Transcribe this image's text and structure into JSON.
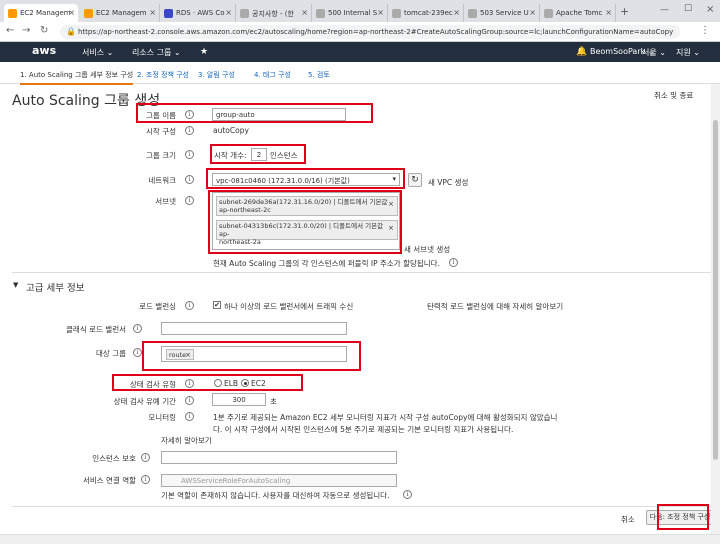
{
  "browser": {
    "tabs": [
      {
        "label": "EC2 Managem",
        "color": "#f90"
      },
      {
        "label": "EC2 Managem",
        "color": "#f90"
      },
      {
        "label": "RDS · AWS Co",
        "color": "#3b48cc"
      },
      {
        "label": "공지사항 - (한",
        "color": "#888"
      },
      {
        "label": "500 Internal S",
        "color": "#888"
      },
      {
        "label": "tomcat-239ec",
        "color": "#888"
      },
      {
        "label": "503 Service U",
        "color": "#888"
      },
      {
        "label": "Apache Tomc",
        "color": "#888"
      }
    ],
    "url": "https://ap-northeast-2.console.aws.amazon.com/ec2/autoscaling/home?region=ap-northeast-2#CreateAutoScalingGroup:source=lc;launchConfigurationName=autoCopy"
  },
  "nav": {
    "logo": "aws",
    "services": "서비스 ⌄",
    "resource_groups": "리소스 그룹 ⌄",
    "user": "BeomSooPark ⌄",
    "region": "서울 ⌄",
    "support": "지원 ⌄"
  },
  "steps": [
    "1. Auto Scaling 그룹 세부 정보 구성",
    "2. 조정 정책 구성",
    "3. 알림 구성",
    "4. 태그 구성",
    "5. 검토"
  ],
  "page": {
    "title": "Auto Scaling 그룹 생성",
    "cancel_review": "취소 및 종료"
  },
  "form": {
    "group_name_label": "그룹 이름",
    "group_name_value": "group-auto",
    "launch_config_label": "시작 구성",
    "launch_config_value": "autoCopy",
    "group_size_label": "그룹 크기",
    "group_size_prefix": "시작 개수:",
    "group_size_value": "2",
    "group_size_suffix": "인스턴스",
    "network_label": "네트워크",
    "network_value": "vpc-081c0460 (172.31.0.0/16) (기본값)",
    "new_vpc": "새 VPC 생성",
    "subnet_label": "서브넷",
    "subnets": [
      {
        "line1": "subnet-269de36a(172.31.16.0/20) | 디폴트에서 기본값",
        "line2": "ap-northeast-2c"
      },
      {
        "line1": "subnet-04313b6c(172.31.0.0/20) | 디폴트에서 기본값 ap-",
        "line2": "northeast-2a"
      }
    ],
    "new_subnet": "새 서브넷 생성",
    "subnet_note": "현재 Auto Scaling 그룹의 각 인스턴스에 퍼블릭 IP 주소가 할당됩니다."
  },
  "advanced": {
    "title": "고급 세부 정보",
    "lb_label": "로드 밸런싱",
    "lb_check": "하나 이상의 로드 밸런서에서 트래픽 수신",
    "lb_link": "탄력적 로드 밸런싱에 대해 자세히 알아보기",
    "classic_lb_label": "클래식 로드 밸런서",
    "target_group_label": "대상 그룹",
    "target_group_tag": "route",
    "health_check_label": "상태 검사 유형",
    "health_elb": "ELB",
    "health_ec2": "EC2",
    "grace_label": "상태 검사 유예 기간",
    "grace_value": "300",
    "grace_unit": "초",
    "monitoring_label": "모니터링",
    "monitoring_text1": "1분 주기로 제공되는 Amazon EC2 세부 모니터링 지표가 시작 구성 autoCopy에 대해 활성화되지 않았습니",
    "monitoring_text2": "다. 이 시작 구성에서 시작된 인스턴스에 5분 주기로 제공되는 기본 모니터링 지표가 사용됩니다.",
    "monitoring_link": "자세히 알아보기",
    "protect_label": "인스턴스 보호",
    "slr_label": "서비스 연결 역할",
    "slr_value": "AWSServiceRoleForAutoScaling",
    "slr_note": "기본 역할이 존재하지 않습니다. 사용자를 대신하여 자동으로 생성됩니다."
  },
  "footer": {
    "cancel": "취소",
    "next": "다음: 조정 정책 구성"
  },
  "colors": {
    "highlight": "#e0001b",
    "link": "#1166bb",
    "nav_bg": "#232f3e",
    "next_btn": "#f0f0f0"
  }
}
